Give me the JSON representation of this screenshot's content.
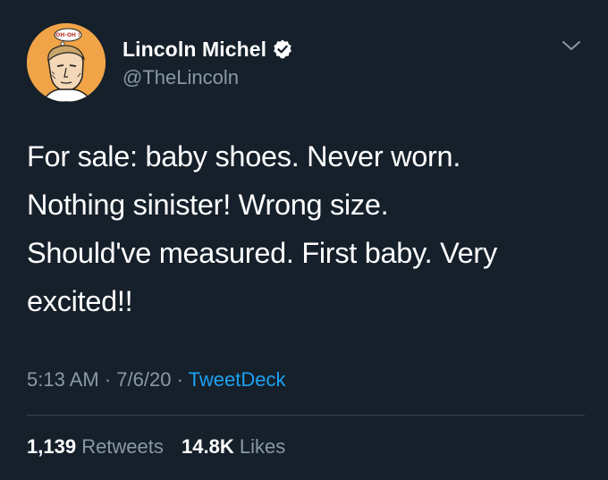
{
  "author": {
    "display_name": "Lincoln Michel",
    "handle": "@TheLincoln",
    "verified": true,
    "avatar_caption": "OH-OH !",
    "avatar_icon": "comic-man-portrait-icon"
  },
  "tweet": {
    "text": "For sale: baby shoes. Never worn.\nNothing sinister! Wrong size.\nShould've measured. First baby. Very\nexcited!!",
    "time": "5:13 AM",
    "date": "7/6/20",
    "separator": "·",
    "source": "TweetDeck"
  },
  "stats": {
    "retweets_count": "1,139",
    "retweets_label": "Retweets",
    "likes_count": "14.8K",
    "likes_label": "Likes"
  },
  "icons": {
    "verified": "verified-badge-icon",
    "menu": "chevron-down-icon"
  },
  "colors": {
    "background": "#15202b",
    "primary_text": "#ffffff",
    "secondary_text": "#8899a6",
    "link": "#1da1f2",
    "divider": "#38444d",
    "avatar_bg": "#f0a447"
  }
}
